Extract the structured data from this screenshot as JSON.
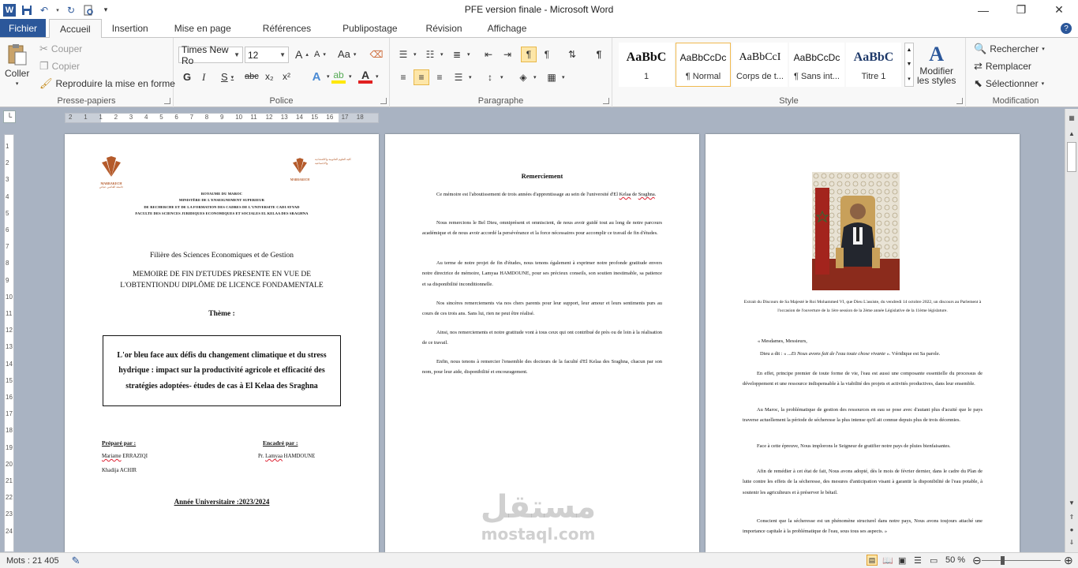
{
  "window": {
    "title": "PFE version finale  -  Microsoft Word",
    "qat_logo": "W",
    "controls": {
      "minimize": "—",
      "restore": "❐",
      "close": "✕"
    }
  },
  "tabs": [
    "Fichier",
    "Accueil",
    "Insertion",
    "Mise en page",
    "Références",
    "Publipostage",
    "Révision",
    "Affichage"
  ],
  "ribbon": {
    "clipboard": {
      "paste": "Coller",
      "cut": "Couper",
      "copy": "Copier",
      "format_painter": "Reproduire la mise en forme",
      "label": "Presse-papiers"
    },
    "font": {
      "family": "Times New Ro",
      "size": "12",
      "bold": "G",
      "italic": "I",
      "underline": "S",
      "strike": "abc",
      "subscript": "x₂",
      "superscript": "x²",
      "grow": "A",
      "shrink": "A",
      "case": "Aa",
      "label": "Police"
    },
    "paragraph": {
      "label": "Paragraphe"
    },
    "styles": {
      "items": [
        {
          "sample": "AaBbC",
          "name": "1"
        },
        {
          "sample": "AaBbCcDc",
          "name": "¶ Normal"
        },
        {
          "sample": "AaBbCcI",
          "name": "Corps de t..."
        },
        {
          "sample": "AaBbCcDc",
          "name": "¶ Sans int..."
        },
        {
          "sample": "AaBbC",
          "name": "Titre 1"
        }
      ],
      "modify_line1": "Modifier",
      "modify_line2": "les styles",
      "label": "Style"
    },
    "editing": {
      "find": "Rechercher",
      "replace": "Remplacer",
      "select": "Sélectionner",
      "label": "Modification"
    }
  },
  "ruler": {
    "h_ticks": [
      "2",
      "1",
      "1",
      "2",
      "3",
      "4",
      "5",
      "6",
      "7",
      "8",
      "9",
      "10",
      "11",
      "12",
      "13",
      "14",
      "15",
      "16",
      "17",
      "18"
    ],
    "v_ticks": [
      "1",
      "2",
      "3",
      "4",
      "5",
      "6",
      "7",
      "8",
      "9",
      "10",
      "11",
      "12",
      "13",
      "14",
      "15",
      "16",
      "17",
      "18",
      "19",
      "20",
      "21",
      "22",
      "23",
      "24"
    ]
  },
  "page1": {
    "logo_left": "MARRAKECH",
    "logo_left_sub": "جامعة القاضي عياض",
    "logo_right": "MARRAKECH",
    "logo_right_sub": "كلية العلوم القانونية والاقتصادية والاجتماعية",
    "header_lines": [
      "ROYAUME DU MAROC",
      "MINISTÈRE DE L'ENSEIGNEMENT SUPERIEUR",
      "DE RECHERCHE ET DE LA FORMATION DES CADRES DE L'UNIVERSITE CADI AYYAD",
      "FACULTE DES SCIENCES JURIDIQUES ECONOMIQUES ET SOCIALES EL KELAA DES SRAGHNA"
    ],
    "filiere": "Filière des Sciences Economiques et de Gestion",
    "memoire_line1": "MEMOIRE DE FIN D'ETUDES PRESENTE EN VUE DE",
    "memoire_line2": "L'OBTENTIONDU DIPLÔME DE LICENCE FONDAMENTALE",
    "theme_label": "Thème :",
    "theme_text": "L'or bleu face aux défis du changement climatique et du stress hydrique : impact sur la productivité agricole et efficacité des stratégies adoptées- études de cas à El Kelaa des Sraghna",
    "prepare_label": "Préparé par :",
    "encadre_label": "Encadré par :",
    "student1_first": "Mariame",
    "student1_last": " ERRAZIQI",
    "student2": "Khadija ACHIR",
    "supervisor_prefix": "Pr. ",
    "supervisor_first": "Lamyaa",
    "supervisor_last": " HAMDOUNE",
    "year": "Année Universitaire :2023/2024"
  },
  "page2": {
    "title": "Remerciement",
    "paragraphs": [
      "Ce mémoire est l'aboutissement de trois années d'apprentissage au sein de l'université d'El Kelaa de Sraghna.",
      "Nous remercions le Bel Dieu, omniprésent et omniscient, de nous avoir guidé tout au long de notre parcours académique et de nous avoir accordé la persévérance et la force nécessaires pour accomplir ce travail de fin d'études.",
      "Au terme de notre projet de fin d'études, nous tenons également à exprimer notre profonde gratitude envers notre directrice de mémoire, Lamyaa HAMDOUNE, pour ses précieux conseils, son soutien inestimable, sa patience et sa disponibilité inconditionnelle.",
      "Nos sincères remerciements via nos chers parents pour leur support, leur amour et leurs sentiments purs au cours de ces trois ans. Sans lui, rien ne peut être réalisé.",
      "Ainsi, nos remerciements et notre gratitude vont à tous ceux qui ont contribué de près ou de loin à la réalisation de ce travail.",
      "Enfin, nous tenons à remercier l'ensemble des docteurs de la faculté d'El Kelaa des Sraghna, chacun par son nom, pour leur aide, disponibilité et encouragement."
    ]
  },
  "page3": {
    "caption": "Extrait du Discours de Sa Majesté le Roi Mohammed VI, que Dieu L'assiste, du vendredi 14 octobre 2022, un discours au Parlement à l'occasion de l'ouverture de la 1ère session de la 2ème année Législative de la 11ème législature.",
    "greeting": "« Mesdames, Messieurs,",
    "quote": "Dieu a dit : « ...Et Nous avons fait de l'eau toute chose vivante ». Véridique est Sa parole.",
    "paragraphs": [
      "En effet, principe premier de toute forme de vie, l'eau est aussi une composante essentielle du processus de développement et une ressource indispensable à la viabilité des projets et activités productives, dans leur ensemble.",
      "Au Maroc, la problématique de gestion des ressources en eau se pose avec d'autant plus d'acuité que le pays traverse actuellement la période de sécheresse la plus intense qu'il ait connue depuis plus de trois décennies.",
      "Face à cette épreuve, Nous implorons le Seigneur de gratifier notre pays de pluies bienfaisantes.",
      "Afin de remédier à cet état de fait, Nous avons adopté, dès le mois de février dernier, dans le cadre du Plan de lutte contre les effets de la sécheresse, des mesures d'anticipation visant à garantir la disponibilité de l'eau potable, à soutenir les agriculteurs et à préserver le bétail.",
      "Conscient que la sécheresse est un phénomène structurel dans notre pays, Nous avons toujours attaché une importance capitale à la problématique de l'eau, sous tous ses aspects. »"
    ]
  },
  "watermark": {
    "arabic": "مستقل",
    "latin": "mostaql.com"
  },
  "status": {
    "words": "Mots : 21 405",
    "zoom": "50 %"
  },
  "colors": {
    "brand": "#2b579a",
    "page_bg": "#a9b3c2",
    "style_selected": "#f0b94f",
    "spelling": "#dd2222"
  }
}
